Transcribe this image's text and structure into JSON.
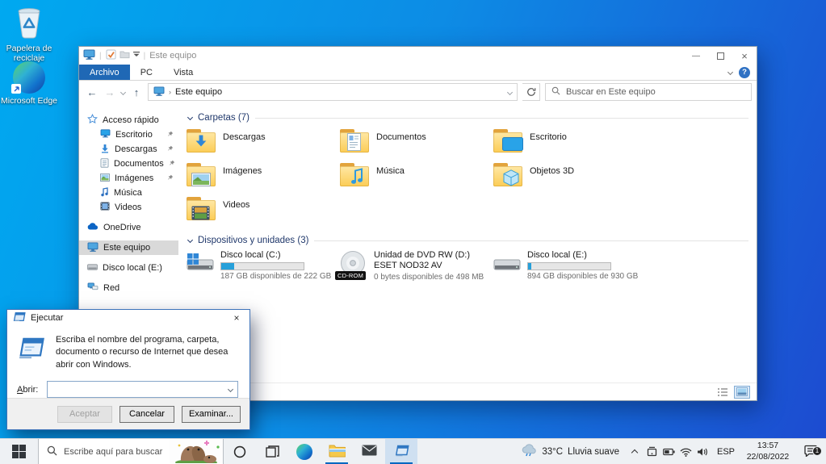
{
  "icons": {
    "back": "←",
    "forward": "→",
    "up": "↑",
    "close": "×",
    "minimize": "—"
  },
  "desktop": {
    "recycle_bin_label": "Papelera de reciclaje",
    "edge_label": "Microsoft Edge"
  },
  "explorer": {
    "window_title": "Este equipo",
    "menu_tabs": [
      "Archivo",
      "PC",
      "Vista"
    ],
    "breadcrumb": "Este equipo",
    "search_placeholder": "Buscar en Este equipo",
    "sidebar": {
      "items": [
        {
          "label": "Acceso rápido"
        },
        {
          "label": "Escritorio"
        },
        {
          "label": "Descargas"
        },
        {
          "label": "Documentos"
        },
        {
          "label": "Imágenes"
        },
        {
          "label": "Música"
        },
        {
          "label": "Videos"
        },
        {
          "label": "OneDrive"
        },
        {
          "label": "Este equipo"
        },
        {
          "label": "Disco local (E:)"
        },
        {
          "label": "Red"
        }
      ]
    },
    "folders_group_label": "Carpetas (7)",
    "folders": [
      {
        "name": "Descargas"
      },
      {
        "name": "Documentos"
      },
      {
        "name": "Escritorio"
      },
      {
        "name": "Imágenes"
      },
      {
        "name": "Música"
      },
      {
        "name": "Objetos 3D"
      },
      {
        "name": "Videos"
      }
    ],
    "drives_group_label": "Dispositivos y unidades (3)",
    "drives": [
      {
        "name": "Disco local (C:)",
        "info": "187 GB disponibles de 222 GB",
        "used_percent": 16
      },
      {
        "name": "Unidad de DVD RW (D:) ESET NOD32 AV",
        "info": "0 bytes disponibles de 498 MB",
        "badge": "CD-ROM"
      },
      {
        "name": "Disco local (E:)",
        "info": "894 GB disponibles de 930 GB",
        "used_percent": 4
      }
    ]
  },
  "run_dialog": {
    "title": "Ejecutar",
    "message": "Escriba el nombre del programa, carpeta, documento o recurso de Internet que desea abrir con Windows.",
    "open_label": "Abrir:",
    "open_value": "",
    "ok_label": "Aceptar",
    "cancel_label": "Cancelar",
    "browse_label": "Examinar..."
  },
  "taskbar": {
    "search_placeholder": "Escribe aquí para buscar",
    "weather_temp": "33°C",
    "weather_condition": "Lluvia suave",
    "language": "ESP",
    "time": "13:57",
    "date": "22/08/2022",
    "notification_count": "1"
  },
  "colors": {
    "accent": "#0067c0",
    "file_tab": "#1f68b5",
    "selection_gray": "#d9d9d9",
    "drive_fill": "#26a0da"
  }
}
